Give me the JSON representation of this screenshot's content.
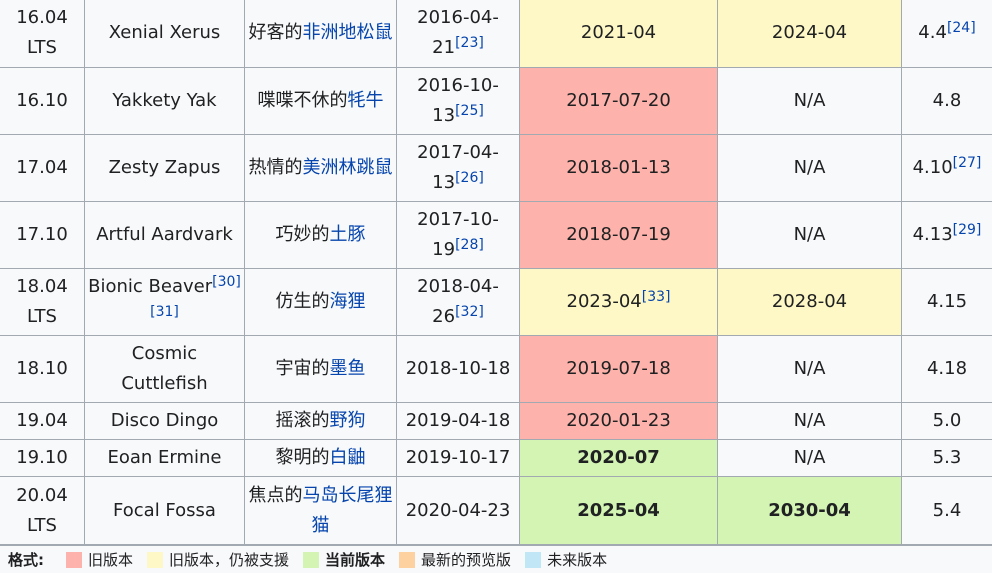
{
  "table": {
    "rows": [
      {
        "version_line1": "16.04",
        "version_line2": "LTS",
        "codename": "Xenial Xerus",
        "meaning_prefix": "好客的",
        "meaning_link": "非洲地松鼠",
        "release_date": "2016-04-21",
        "release_ref": "[23]",
        "eol": "2021-04",
        "eol_ref": "",
        "eol_status": "supported",
        "esm": "2024-04",
        "esm_status": "supported",
        "kernel": "4.4",
        "kernel_ref": "[24]"
      },
      {
        "version_line1": "16.10",
        "version_line2": "",
        "codename": "Yakkety Yak",
        "meaning_prefix": "喋喋不休的",
        "meaning_link": "牦牛",
        "release_date": "2016-10-13",
        "release_ref": "[25]",
        "eol": "2017-07-20",
        "eol_ref": "",
        "eol_status": "old",
        "esm": "N/A",
        "esm_status": "none",
        "kernel": "4.8",
        "kernel_ref": ""
      },
      {
        "version_line1": "17.04",
        "version_line2": "",
        "codename": "Zesty Zapus",
        "meaning_prefix": "热情的",
        "meaning_link": "美洲林跳鼠",
        "release_date": "2017-04-13",
        "release_ref": "[26]",
        "eol": "2018-01-13",
        "eol_ref": "",
        "eol_status": "old",
        "esm": "N/A",
        "esm_status": "none",
        "kernel": "4.10",
        "kernel_ref": "[27]"
      },
      {
        "version_line1": "17.10",
        "version_line2": "",
        "codename": "Artful Aardvark",
        "meaning_prefix": "巧妙的",
        "meaning_link": "土豚",
        "release_date": "2017-10-19",
        "release_ref": "[28]",
        "eol": "2018-07-19",
        "eol_ref": "",
        "eol_status": "old",
        "esm": "N/A",
        "esm_status": "none",
        "kernel": "4.13",
        "kernel_ref": "[29]"
      },
      {
        "version_line1": "18.04",
        "version_line2": "LTS",
        "codename": "Bionic Beaver",
        "codename_refs": "[30][31]",
        "meaning_prefix": "仿生的",
        "meaning_link": "海狸",
        "release_date": "2018-04-26",
        "release_ref": "[32]",
        "eol": "2023-04",
        "eol_ref": "[33]",
        "eol_status": "supported",
        "esm": "2028-04",
        "esm_status": "supported",
        "kernel": "4.15",
        "kernel_ref": ""
      },
      {
        "version_line1": "18.10",
        "version_line2": "",
        "codename": "Cosmic Cuttlefish",
        "meaning_prefix": "宇宙的",
        "meaning_link": "墨鱼",
        "release_date": "2018-10-18",
        "release_ref": "",
        "eol": "2019-07-18",
        "eol_ref": "",
        "eol_status": "old",
        "esm": "N/A",
        "esm_status": "none",
        "kernel": "4.18",
        "kernel_ref": ""
      },
      {
        "version_line1": "19.04",
        "version_line2": "",
        "codename": "Disco Dingo",
        "meaning_prefix": "摇滚的",
        "meaning_link": "野狗",
        "release_date": "2019-04-18",
        "release_ref": "",
        "eol": "2020-01-23",
        "eol_ref": "",
        "eol_status": "old",
        "esm": "N/A",
        "esm_status": "none",
        "kernel": "5.0",
        "kernel_ref": ""
      },
      {
        "version_line1": "19.10",
        "version_line2": "",
        "codename": "Eoan Ermine",
        "meaning_prefix": "黎明的",
        "meaning_link": "白鼬",
        "release_date": "2019-10-17",
        "release_ref": "",
        "eol": "2020-07",
        "eol_ref": "",
        "eol_status": "current",
        "esm": "N/A",
        "esm_status": "none",
        "kernel": "5.3",
        "kernel_ref": ""
      },
      {
        "version_line1": "20.04",
        "version_line2": "LTS",
        "codename": "Focal Fossa",
        "meaning_prefix": "焦点的",
        "meaning_link": "马岛长尾狸猫",
        "release_date": "2020-04-23",
        "release_ref": "",
        "eol": "2025-04",
        "eol_ref": "",
        "eol_status": "current",
        "esm": "2030-04",
        "esm_status": "current",
        "kernel": "5.4",
        "kernel_ref": ""
      }
    ]
  },
  "legend": {
    "title": "格式:",
    "items": [
      {
        "label": "旧版本",
        "color": "#fdb3ab",
        "bold": false
      },
      {
        "label": "旧版本，仍被支援",
        "color": "#fef8c6",
        "bold": false
      },
      {
        "label": "当前版本",
        "color": "#d4f4b4",
        "bold": true
      },
      {
        "label": "最新的预览版",
        "color": "#fed1a0",
        "bold": false
      },
      {
        "label": "未来版本",
        "color": "#c1e6f5",
        "bold": false
      }
    ]
  }
}
